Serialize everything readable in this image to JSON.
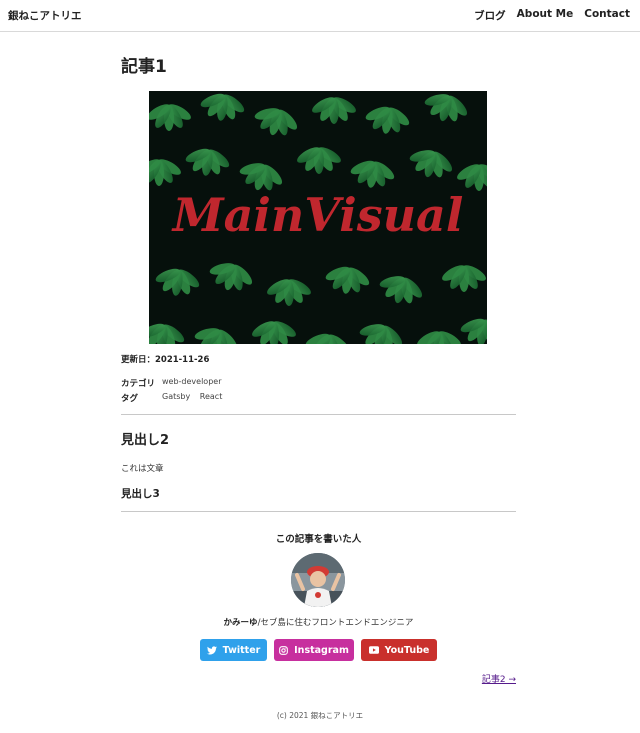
{
  "header": {
    "site_title": "銀ねこアトリエ",
    "nav": [
      {
        "label": "ブログ"
      },
      {
        "label": "About Me"
      },
      {
        "label": "Contact"
      }
    ]
  },
  "article": {
    "title": "記事1",
    "hero_text": "MainVisual",
    "updated": "更新日：2021-11-26",
    "category_label": "カテゴリ",
    "category_value": "web-developer",
    "tag_label": "タグ",
    "tags": [
      "Gatsby",
      "React"
    ],
    "heading2": "見出し2",
    "body": "これは文章",
    "heading3": "見出し3"
  },
  "author": {
    "heading": "この記事を書いた人",
    "name": "かみーゆ",
    "description": "/セブ島に住むフロントエンドエンジニア"
  },
  "social": [
    {
      "label": "Twitter",
      "color": "#2fa1eb",
      "icon": "twitter-icon"
    },
    {
      "label": "Instagram",
      "color": "#c72f9e",
      "icon": "instagram-icon"
    },
    {
      "label": "YouTube",
      "color": "#c9302c",
      "icon": "youtube-icon"
    }
  ],
  "next_link": "記事2 →",
  "footer": "(c) 2021 銀ねこアトリエ"
}
